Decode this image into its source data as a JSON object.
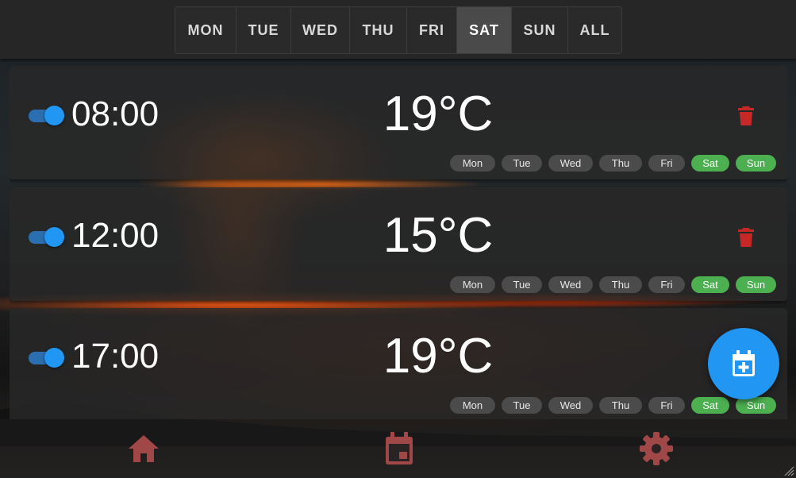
{
  "day_tabs": [
    {
      "label": "MON",
      "active": false
    },
    {
      "label": "TUE",
      "active": false
    },
    {
      "label": "WED",
      "active": false
    },
    {
      "label": "THU",
      "active": false
    },
    {
      "label": "FRI",
      "active": false
    },
    {
      "label": "SAT",
      "active": true
    },
    {
      "label": "SUN",
      "active": false
    },
    {
      "label": "ALL",
      "active": false
    }
  ],
  "schedules": [
    {
      "enabled": true,
      "time": "08:00",
      "temperature": "19°C",
      "days": [
        {
          "label": "Mon",
          "on": false
        },
        {
          "label": "Tue",
          "on": false
        },
        {
          "label": "Wed",
          "on": false
        },
        {
          "label": "Thu",
          "on": false
        },
        {
          "label": "Fri",
          "on": false
        },
        {
          "label": "Sat",
          "on": true
        },
        {
          "label": "Sun",
          "on": true
        }
      ]
    },
    {
      "enabled": true,
      "time": "12:00",
      "temperature": "15°C",
      "days": [
        {
          "label": "Mon",
          "on": false
        },
        {
          "label": "Tue",
          "on": false
        },
        {
          "label": "Wed",
          "on": false
        },
        {
          "label": "Thu",
          "on": false
        },
        {
          "label": "Fri",
          "on": false
        },
        {
          "label": "Sat",
          "on": true
        },
        {
          "label": "Sun",
          "on": true
        }
      ]
    },
    {
      "enabled": true,
      "time": "17:00",
      "temperature": "19°C",
      "days": [
        {
          "label": "Mon",
          "on": false
        },
        {
          "label": "Tue",
          "on": false
        },
        {
          "label": "Wed",
          "on": false
        },
        {
          "label": "Thu",
          "on": false
        },
        {
          "label": "Fri",
          "on": false
        },
        {
          "label": "Sat",
          "on": true
        },
        {
          "label": "Sun",
          "on": true
        }
      ]
    }
  ],
  "fab": {
    "icon": "calendar-add-icon"
  },
  "bottom_nav": [
    {
      "icon": "home-icon"
    },
    {
      "icon": "calendar-icon"
    },
    {
      "icon": "gear-icon"
    }
  ],
  "colors": {
    "accent_blue": "#2196f3",
    "day_on_green": "#4caf50",
    "delete_red": "#c62828",
    "nav_icon": "#a04848"
  }
}
